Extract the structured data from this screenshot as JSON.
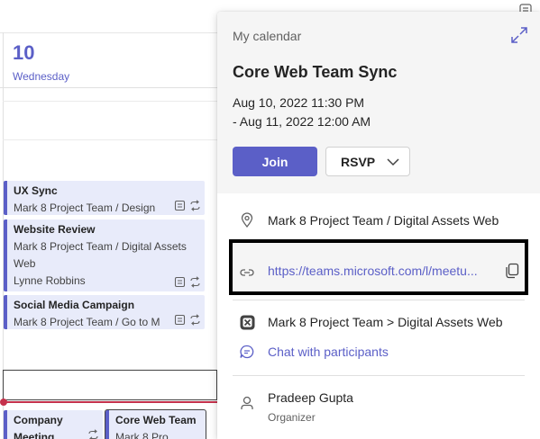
{
  "calendar": {
    "day_number": "10",
    "day_name": "Wednesday",
    "events": [
      {
        "title": "UX Sync",
        "lines": [
          "Mark 8 Project Team / Design"
        ]
      },
      {
        "title": "Website Review",
        "lines": [
          "Mark 8 Project Team / Digital Assets",
          "Web",
          "Lynne Robbins"
        ]
      },
      {
        "title": "Social Media Campaign",
        "lines": [
          "Mark 8 Project Team / Go to M"
        ]
      },
      {
        "title": "Company",
        "lines": [
          "Meeting"
        ]
      },
      {
        "title": "Core Web Team",
        "lines": [
          "Mark 8 Pro"
        ]
      }
    ]
  },
  "popup": {
    "calendar_name": "My calendar",
    "title": "Core Web Team Sync",
    "time_start": "Aug 10, 2022 11:30 PM",
    "time_end": "- Aug 11, 2022 12:00 AM",
    "join_label": "Join",
    "rsvp_label": "RSVP",
    "location": "Mark 8 Project Team / Digital Assets Web",
    "meeting_link": "https://teams.microsoft.com/l/meetu...",
    "channel": "Mark 8 Project Team > Digital Assets Web",
    "chat_label": "Chat with participants",
    "organizer_name": "Pradeep Gupta",
    "organizer_role": "Organizer"
  },
  "colors": {
    "accent": "#5b5fc7",
    "event_bg": "#e8ebfa",
    "now_line": "#c4314b"
  },
  "icons": [
    "expand-icon",
    "location-pin-icon",
    "link-icon",
    "copy-icon",
    "teams-channel-icon",
    "chat-bubble-icon",
    "person-icon",
    "chevron-down-icon",
    "notes-icon",
    "recurring-icon"
  ]
}
